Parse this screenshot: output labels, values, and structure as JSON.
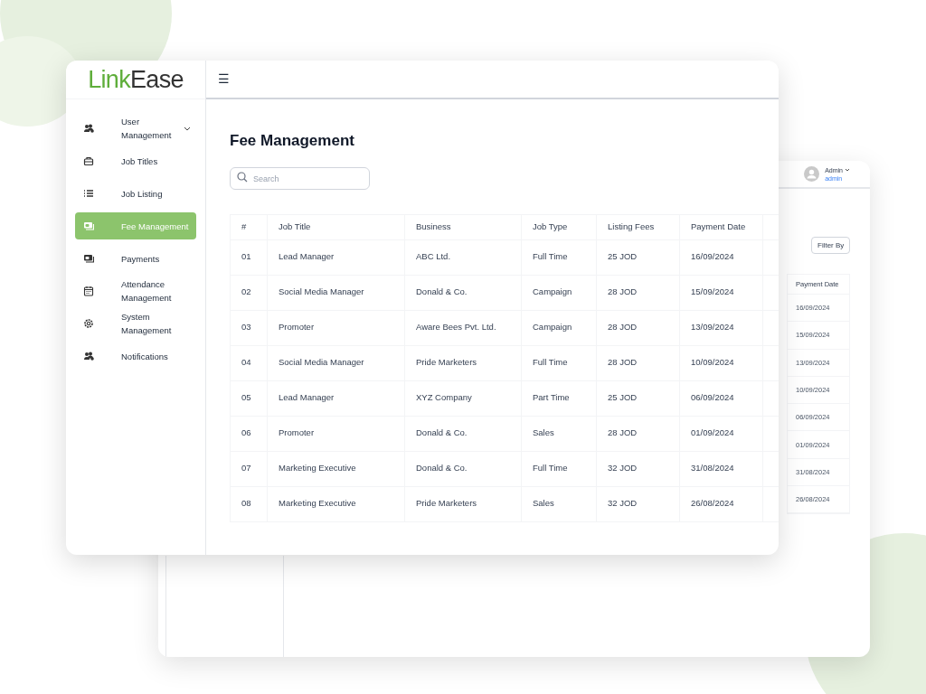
{
  "logo": {
    "accent": "Link",
    "rest": "Ease"
  },
  "menu_icon": "☰",
  "sidebar": {
    "items": [
      {
        "label": "User Management",
        "submenu": true,
        "selected": false
      },
      {
        "label": "Job Titles",
        "submenu": false,
        "selected": false
      },
      {
        "label": "Job Listing",
        "submenu": false,
        "selected": false
      },
      {
        "label": "Fee Management",
        "submenu": false,
        "selected": true
      },
      {
        "label": "Payments",
        "submenu": false,
        "selected": false
      },
      {
        "label": "Attendance Management",
        "submenu": false,
        "selected": false
      },
      {
        "label": "System Management",
        "submenu": false,
        "selected": false
      },
      {
        "label": "Notifications",
        "submenu": false,
        "selected": false
      }
    ]
  },
  "page_title": "Fee Management",
  "search": {
    "placeholder": "Search"
  },
  "table": {
    "columns": [
      "#",
      "Job Title",
      "Business",
      "Job Type",
      "Listing Fees",
      "Payment Date"
    ],
    "rows": [
      [
        "01",
        "Lead Manager",
        "ABC Ltd.",
        "Full Time",
        "25 JOD",
        "16/09/2024"
      ],
      [
        "02",
        "Social Media Manager",
        "Donald & Co.",
        "Campaign",
        "28 JOD",
        "15/09/2024"
      ],
      [
        "03",
        "Promoter",
        "Aware Bees Pvt. Ltd.",
        "Campaign",
        "28 JOD",
        "13/09/2024"
      ],
      [
        "04",
        "Social Media Manager",
        "Pride Marketers",
        "Full Time",
        "28 JOD",
        "10/09/2024"
      ],
      [
        "05",
        "Lead Manager",
        "XYZ Company",
        "Part Time",
        "25 JOD",
        "06/09/2024"
      ],
      [
        "06",
        "Promoter",
        "Donald & Co.",
        "Sales",
        "28 JOD",
        "01/09/2024"
      ],
      [
        "07",
        "Marketing Executive",
        "Donald & Co.",
        "Full Time",
        "32 JOD",
        "31/08/2024"
      ],
      [
        "08",
        "Marketing Executive",
        "Pride Marketers",
        "Sales",
        "32 JOD",
        "26/08/2024"
      ]
    ]
  },
  "back_window": {
    "user_name": "Admin",
    "user_role": "admin",
    "filter_button": "Filter By",
    "column": "Payment Date",
    "dates": [
      "16/09/2024",
      "15/09/2024",
      "13/09/2024",
      "10/09/2024",
      "06/09/2024",
      "01/09/2024",
      "31/08/2024",
      "26/08/2024"
    ]
  }
}
